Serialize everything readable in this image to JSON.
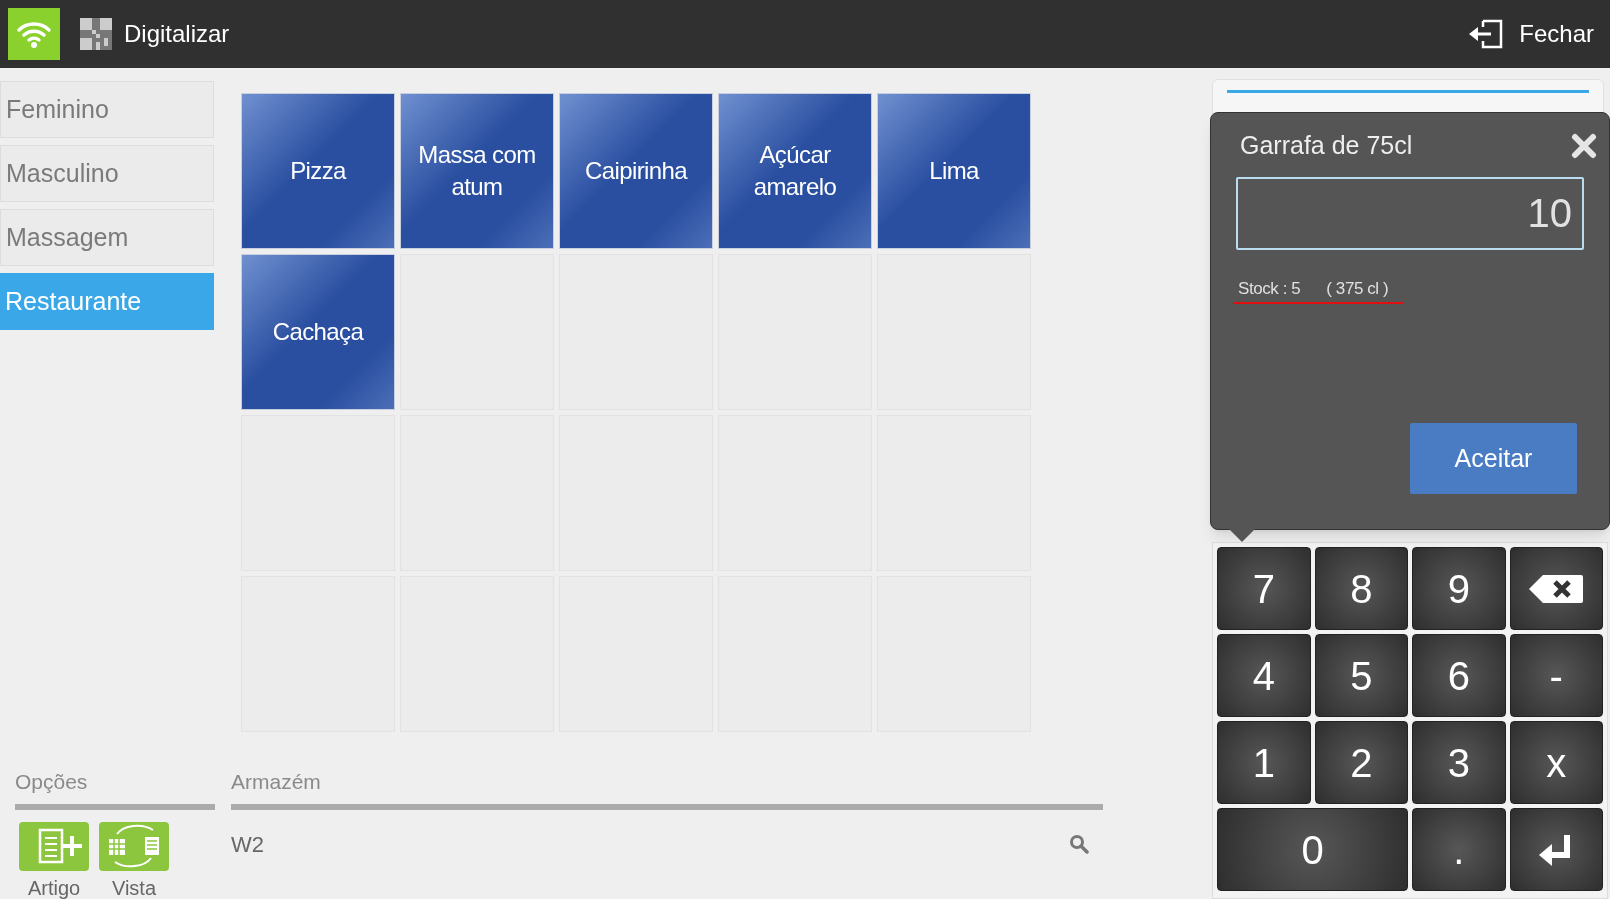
{
  "top_bar": {
    "scan_label": "Digitalizar",
    "close_label": "Fechar"
  },
  "sidebar": {
    "items": [
      {
        "label": "Feminino",
        "selected": false
      },
      {
        "label": "Masculino",
        "selected": false
      },
      {
        "label": "Massagem",
        "selected": false
      },
      {
        "label": "Restaurante",
        "selected": true
      }
    ]
  },
  "tiles": [
    {
      "kind": "item",
      "label": "Pizza"
    },
    {
      "kind": "item",
      "label": "Massa com atum"
    },
    {
      "kind": "item",
      "label": "Caipirinha"
    },
    {
      "kind": "item",
      "label": "Açúcar amarelo"
    },
    {
      "kind": "item",
      "label": "Lima"
    },
    {
      "kind": "item",
      "label": "Cachaça"
    },
    {
      "kind": "empty"
    },
    {
      "kind": "empty"
    },
    {
      "kind": "empty"
    },
    {
      "kind": "empty"
    },
    {
      "kind": "empty"
    },
    {
      "kind": "empty"
    },
    {
      "kind": "empty"
    },
    {
      "kind": "empty"
    },
    {
      "kind": "empty"
    },
    {
      "kind": "empty"
    },
    {
      "kind": "empty"
    },
    {
      "kind": "empty"
    },
    {
      "kind": "empty"
    },
    {
      "kind": "empty"
    }
  ],
  "options": {
    "title": "Opções",
    "buttons": [
      {
        "kind": "add_item",
        "label": "Artigo"
      },
      {
        "kind": "view",
        "label": "Vista"
      }
    ]
  },
  "warehouse": {
    "title": "Armazém",
    "value": "W2"
  },
  "popup": {
    "title": "Garrafa de 75cl",
    "value": "10",
    "stock": "Stock : 5",
    "stock_volume": "( 375 cl )",
    "accept": "Aceitar"
  },
  "keypad": [
    {
      "kind": "char",
      "label": "7"
    },
    {
      "kind": "char",
      "label": "8"
    },
    {
      "kind": "char",
      "label": "9"
    },
    {
      "kind": "backspace"
    },
    {
      "kind": "char",
      "label": "4"
    },
    {
      "kind": "char",
      "label": "5"
    },
    {
      "kind": "char",
      "label": "6"
    },
    {
      "kind": "char",
      "label": "-"
    },
    {
      "kind": "char",
      "label": "1"
    },
    {
      "kind": "char",
      "label": "2"
    },
    {
      "kind": "char",
      "label": "3"
    },
    {
      "kind": "char",
      "label": "x"
    },
    {
      "kind": "wide",
      "label": "0"
    },
    {
      "kind": "char",
      "label": "."
    },
    {
      "kind": "enter"
    }
  ]
}
